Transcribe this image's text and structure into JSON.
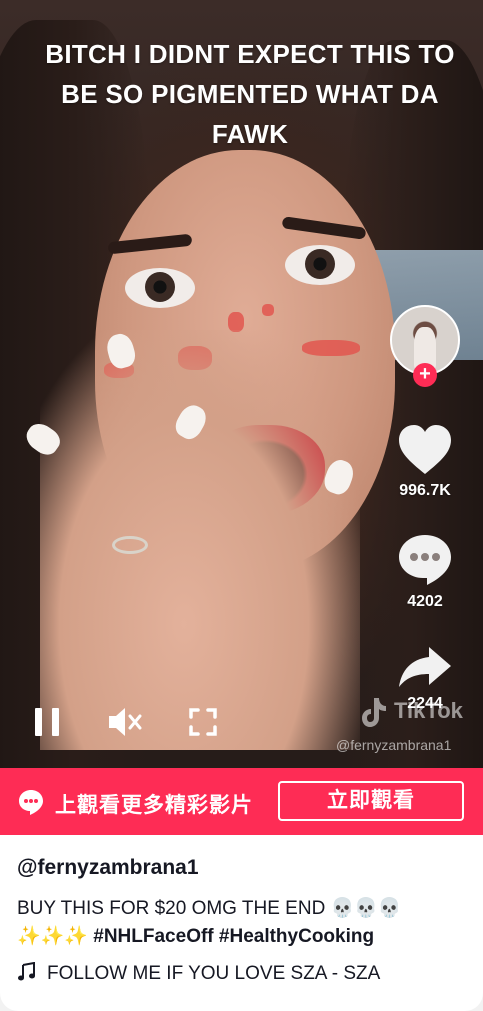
{
  "video": {
    "caption": "BITCH I DIDNT EXPECT THIS TO BE SO PIGMENTED WHAT DA FAWK",
    "watermark_brand": "TikTok",
    "watermark_user": "@fernyzambrana1",
    "likes": "996.7K",
    "comments": "4202",
    "shares": "2244",
    "follow_symbol": "+"
  },
  "promo": {
    "text": "上觀看更多精彩影片",
    "button": "立即觀看",
    "color": "#fe2c55"
  },
  "info": {
    "username": "@fernyzambrana1",
    "description_text": "BUY THIS FOR $20 OMG THE END 💀💀💀 ✨✨✨ ",
    "hashtags": [
      "#NHLFaceOff",
      "#HealthyCooking"
    ],
    "music": "FOLLOW ME IF YOU LOVE SZA - SZA"
  },
  "icons": [
    "pause-icon",
    "mute-icon",
    "fullscreen-icon",
    "heart-icon",
    "comment-icon",
    "share-icon",
    "music-note-icon",
    "chat-bubble-icon"
  ]
}
